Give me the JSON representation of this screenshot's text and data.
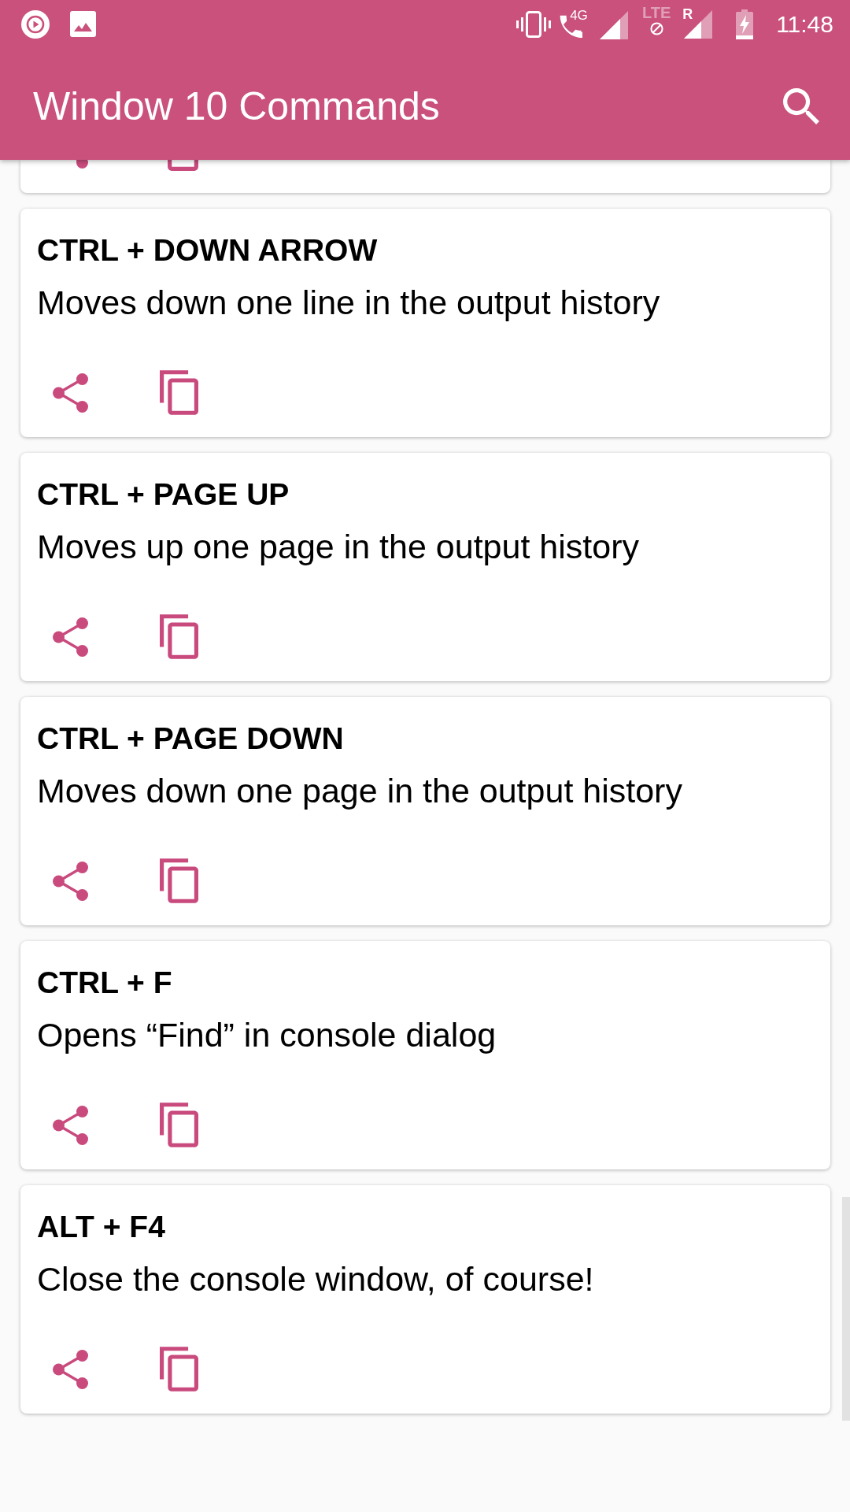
{
  "status_bar": {
    "network_type": "4G",
    "lte_label": "LTE",
    "roaming_label": "R",
    "time": "11:48"
  },
  "app_bar": {
    "title": "Window 10 Commands"
  },
  "cards": [
    {
      "kind": "cut_off"
    },
    {
      "kind": "full",
      "title": "CTRL + DOWN ARROW",
      "description": "Moves down one line in the output history"
    },
    {
      "kind": "full",
      "title": "CTRL + PAGE UP",
      "description": "Moves up one page in the output history"
    },
    {
      "kind": "full",
      "title": "CTRL + PAGE DOWN",
      "description": "Moves down one page in the output history"
    },
    {
      "kind": "full",
      "title": "CTRL + F",
      "description": "Opens “Find” in console dialog"
    },
    {
      "kind": "full",
      "title": "ALT + F4",
      "description": "Close the console window, of course!"
    }
  ]
}
